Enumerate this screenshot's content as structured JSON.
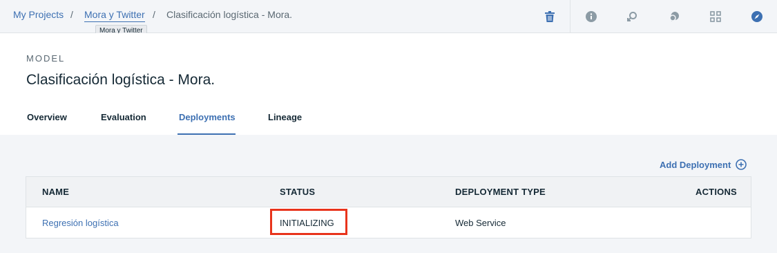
{
  "breadcrumb": {
    "items": [
      {
        "label": "My Projects"
      },
      {
        "label": "Mora y Twitter"
      },
      {
        "label": "Clasificación logística - Mora."
      }
    ],
    "separator": "/",
    "tooltip": "Mora y Twitter"
  },
  "toolbar": {
    "icons": [
      "trash-icon",
      "info-icon",
      "rollback-icon",
      "comments-icon",
      "assets-icon",
      "compass-icon"
    ],
    "accent": "#3d70b2",
    "muted": "#8c9ba5"
  },
  "header": {
    "eyebrow": "MODEL",
    "title": "Clasificación logística - Mora."
  },
  "tabs": [
    {
      "label": "Overview"
    },
    {
      "label": "Evaluation"
    },
    {
      "label": "Deployments",
      "active": true
    },
    {
      "label": "Lineage"
    }
  ],
  "actions": {
    "add_deployment": "Add Deployment"
  },
  "table": {
    "columns": [
      "NAME",
      "STATUS",
      "DEPLOYMENT TYPE",
      "ACTIONS"
    ],
    "rows": [
      {
        "name": "Regresión logística",
        "status": "INITIALIZING",
        "type": "Web Service"
      }
    ]
  },
  "colors": {
    "link": "#3d70b2",
    "highlight": "#e8341c",
    "text": "#152935"
  }
}
